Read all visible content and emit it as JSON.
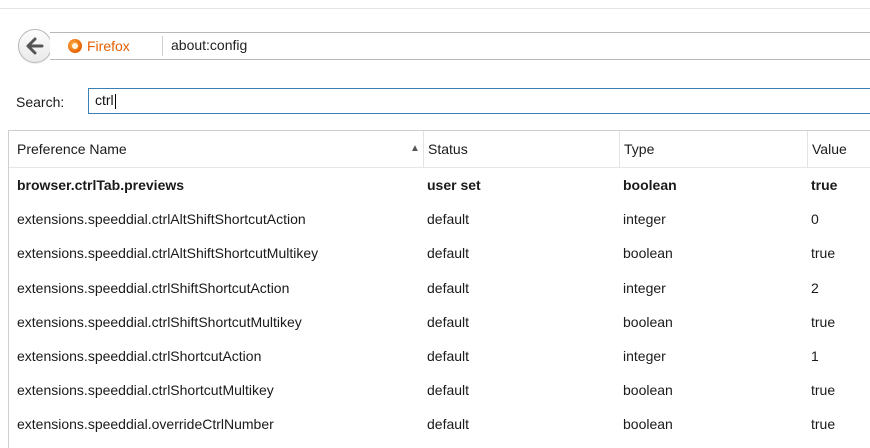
{
  "nav": {
    "identity_label": "Firefox",
    "url": "about:config",
    "brand_color": "#e66000"
  },
  "search": {
    "label": "Search:",
    "value": "ctrl"
  },
  "table": {
    "columns": [
      "Preference Name",
      "Status",
      "Type",
      "Value"
    ],
    "sort_column": "Preference Name",
    "sort_direction": "ascending",
    "rows": [
      {
        "name": "browser.ctrlTab.previews",
        "status": "user set",
        "type": "boolean",
        "value": "true",
        "modified": true
      },
      {
        "name": "extensions.speeddial.ctrlAltShiftShortcutAction",
        "status": "default",
        "type": "integer",
        "value": "0",
        "modified": false
      },
      {
        "name": "extensions.speeddial.ctrlAltShiftShortcutMultikey",
        "status": "default",
        "type": "boolean",
        "value": "true",
        "modified": false
      },
      {
        "name": "extensions.speeddial.ctrlShiftShortcutAction",
        "status": "default",
        "type": "integer",
        "value": "2",
        "modified": false
      },
      {
        "name": "extensions.speeddial.ctrlShiftShortcutMultikey",
        "status": "default",
        "type": "boolean",
        "value": "true",
        "modified": false
      },
      {
        "name": "extensions.speeddial.ctrlShortcutAction",
        "status": "default",
        "type": "integer",
        "value": "1",
        "modified": false
      },
      {
        "name": "extensions.speeddial.ctrlShortcutMultikey",
        "status": "default",
        "type": "boolean",
        "value": "true",
        "modified": false
      },
      {
        "name": "extensions.speeddial.overrideCtrlNumber",
        "status": "default",
        "type": "boolean",
        "value": "true",
        "modified": false
      }
    ]
  }
}
